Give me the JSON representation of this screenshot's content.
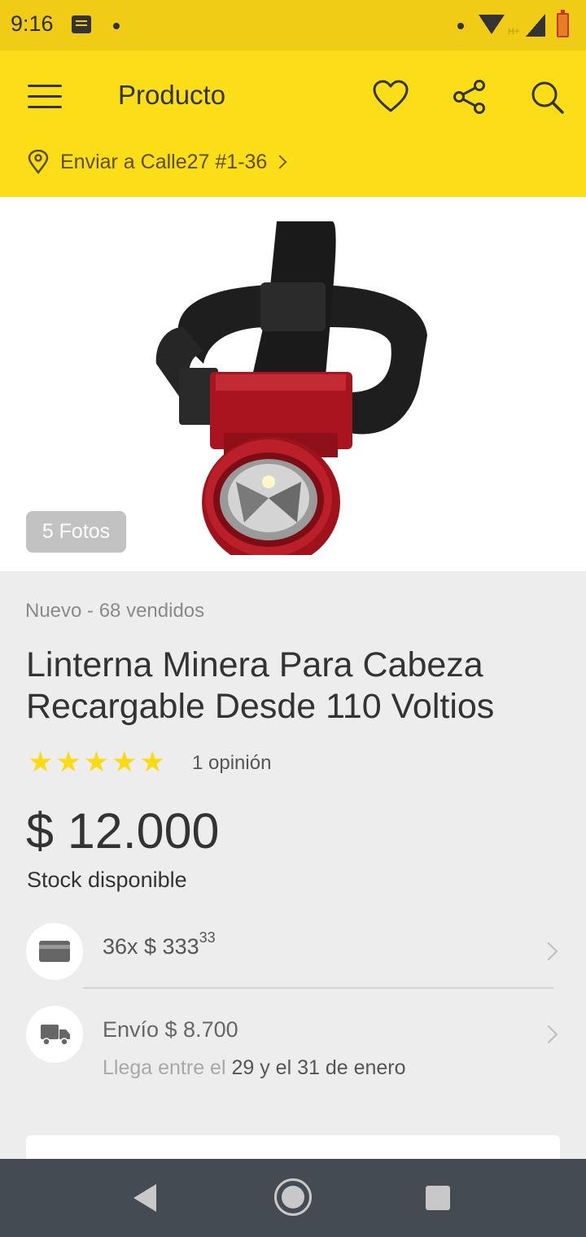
{
  "status_bar": {
    "time": "9:16",
    "network_type": "H+",
    "icons": [
      "notes-icon",
      "dot-icon",
      "wifi-icon",
      "signal-icon",
      "battery-icon"
    ]
  },
  "header": {
    "title": "Producto",
    "menu_icon": "hamburger-menu-icon",
    "actions": [
      "heart-icon",
      "share-icon",
      "search-icon"
    ],
    "ship_to": "Enviar a Calle27 #1-36",
    "background_color": "#fbdd18"
  },
  "gallery": {
    "photos_label": "5 Fotos"
  },
  "product": {
    "condition": "Nuevo - 68 vendidos",
    "title": "Linterna Minera Para Cabeza Recargable Desde 110 Voltios",
    "rating": 5,
    "rating_max": 5,
    "reviews": "1 opinión",
    "price": "$ 12.000",
    "stock": "Stock disponible"
  },
  "payment": {
    "installments_prefix": "36x $ 333",
    "installments_cents": "33"
  },
  "shipping": {
    "cost": "Envío $ 8.700",
    "arrival_prefix": "Llega entre el",
    "arrival_dates": "29 y el 31 de enero"
  },
  "nav_bar": {
    "buttons": [
      "back-icon",
      "home-icon",
      "recent-apps-icon"
    ]
  }
}
